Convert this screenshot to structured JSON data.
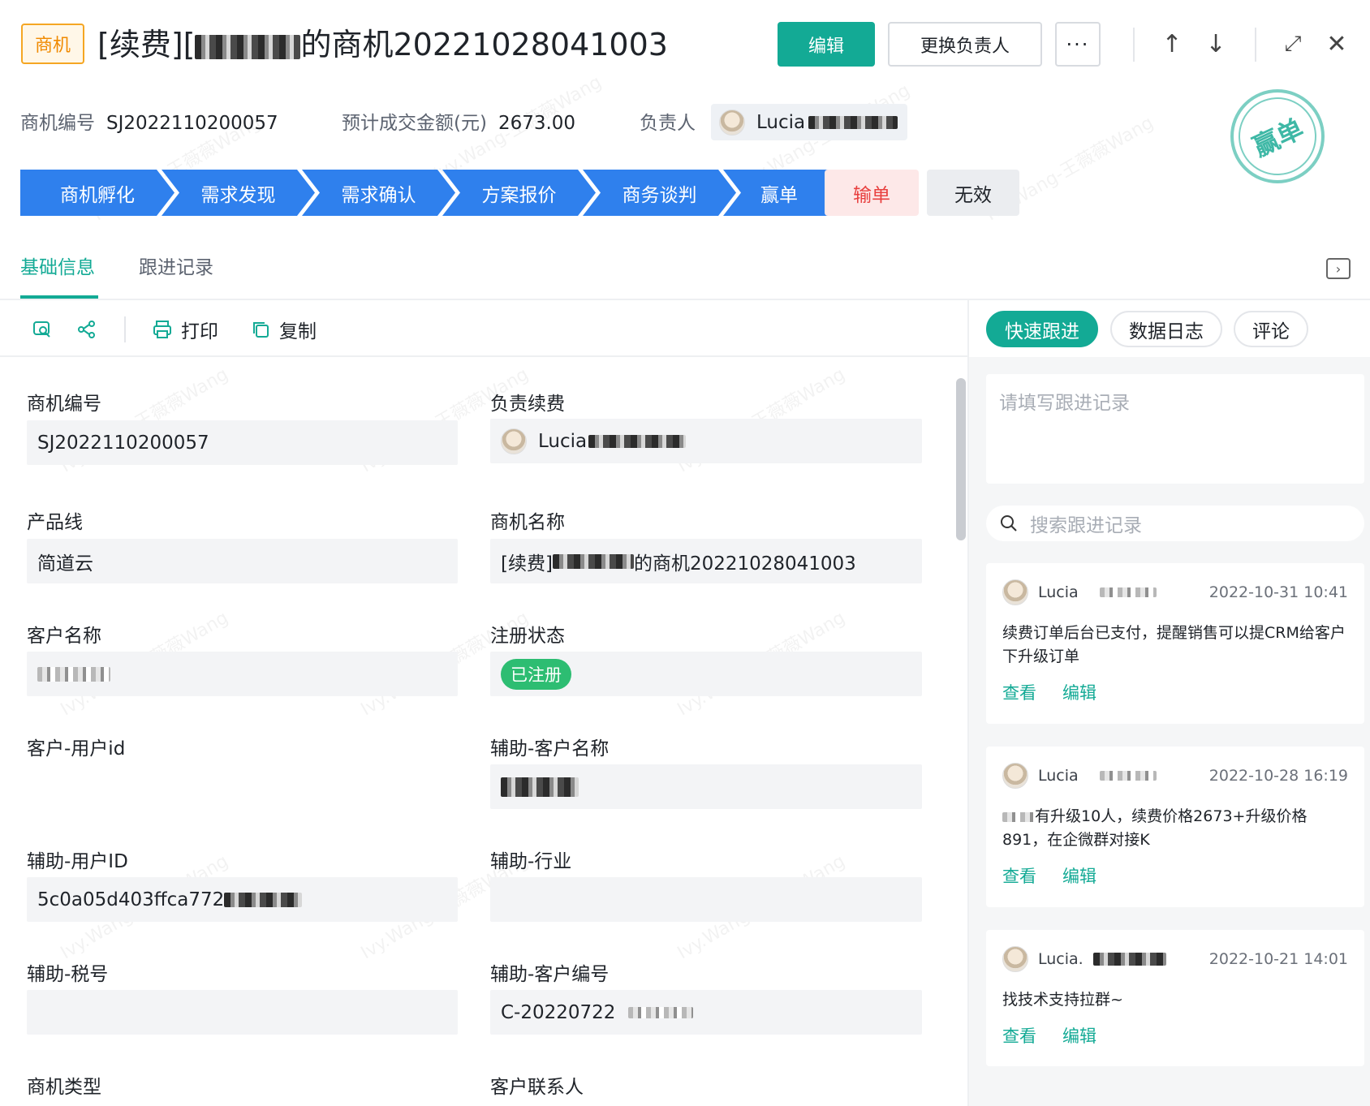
{
  "header": {
    "type_badge": "商机",
    "title_prefix": "[续费][",
    "title_suffix": "的商机20221028041003",
    "edit_label": "编辑",
    "change_owner_label": "更换负责人",
    "more_label": "···",
    "up_icon": "arrow-up-icon",
    "down_icon": "arrow-down-icon",
    "expand_icon": "expand-icon",
    "close_icon": "close-icon"
  },
  "meta": {
    "code_label": "商机编号",
    "code_value": "SJ2022110200057",
    "amount_label": "预计成交金额(元)",
    "amount_value": "2673.00",
    "owner_label": "负责人",
    "owner_name": "Lucia"
  },
  "stamp": "赢单",
  "stages": [
    "商机孵化",
    "需求发现",
    "需求确认",
    "方案报价",
    "商务谈判",
    "赢单"
  ],
  "lose_label": "输单",
  "invalid_label": "无效",
  "tabs": {
    "basic": "基础信息",
    "followup": "跟进记录"
  },
  "toolbar": {
    "print": "打印",
    "copy": "复制"
  },
  "fields": {
    "code": {
      "label": "商机编号",
      "value": "SJ2022110200057"
    },
    "renew_owner": {
      "label": "负责续费",
      "value": "Lucia"
    },
    "product_line": {
      "label": "产品线",
      "value": "简道云"
    },
    "opp_name": {
      "label": "商机名称",
      "prefix": "[续费]",
      "suffix": "的商机20221028041003"
    },
    "customer_name": {
      "label": "客户名称"
    },
    "reg_status": {
      "label": "注册状态",
      "value": "已注册"
    },
    "customer_user_id": {
      "label": "客户-用户id"
    },
    "aux_customer_name": {
      "label": "辅助-客户名称"
    },
    "aux_user_id": {
      "label": "辅助-用户ID",
      "value": "5c0a05d403ffca772"
    },
    "aux_industry": {
      "label": "辅助-行业"
    },
    "aux_tax": {
      "label": "辅助-税号"
    },
    "aux_customer_code": {
      "label": "辅助-客户编号",
      "value": "C-20220722"
    },
    "opp_type": {
      "label": "商机类型"
    },
    "contact": {
      "label": "客户联系人"
    }
  },
  "right_panel": {
    "tabs": [
      "快速跟进",
      "数据日志",
      "评论"
    ],
    "note_placeholder": "请填写跟进记录",
    "search_placeholder": "搜索跟进记录",
    "records": [
      {
        "name": "Lucia",
        "time": "2022-10-31 10:41",
        "text": "续费订单后台已支付，提醒销售可以提CRM给客户下升级订单",
        "view": "查看",
        "edit": "编辑"
      },
      {
        "name": "Lucia",
        "time": "2022-10-28 16:19",
        "text": "有升级10人，续费价格2673+升级价格891，在企微群对接K",
        "view": "查看",
        "edit": "编辑"
      },
      {
        "name": "Lucia.",
        "time": "2022-10-21 14:01",
        "text": "找技术支持拉群~",
        "view": "查看",
        "edit": "编辑"
      }
    ]
  },
  "watermark": "Ivy.Wang-王薇薇Wang"
}
